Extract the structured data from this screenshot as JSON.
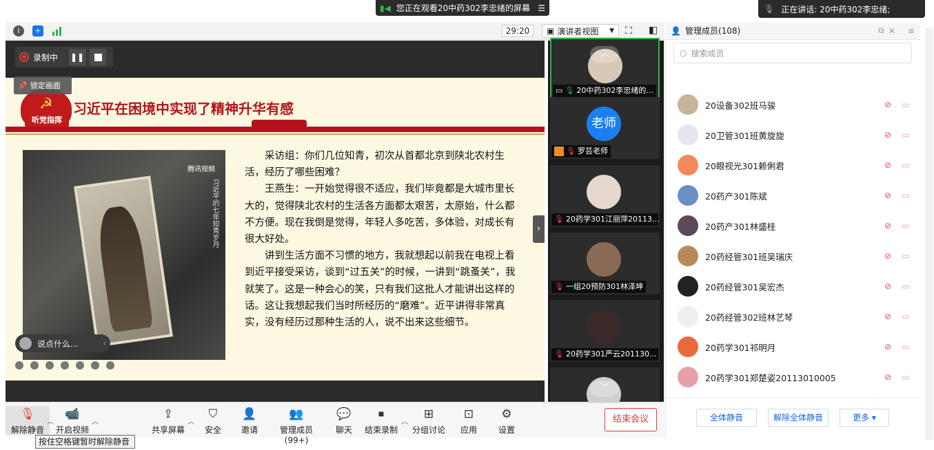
{
  "banner": {
    "share_text": "您正在观看20中药302李忠绪的屏幕",
    "speaking_text": "正在讲话: 20中药302李忠绪;"
  },
  "toolbar": {
    "timer": "29:20",
    "view_label": "演讲者视图"
  },
  "recording": {
    "label": "录制中",
    "lock_label": "锁定画面"
  },
  "slide": {
    "badge": "听党指挥",
    "title": "习近平在困境中实现了精神升华有感",
    "brand": "腾讯视频",
    "vertical_text": "习近平的七年知青岁月",
    "paragraphs": [
      "采访组：你们几位知青，初次从首都北京到陕北农村生活，经历了哪些困难？",
      "王燕生：一开始觉得很不适应，我们毕竟都是大城市里长大的，觉得陕北农村的生活各方面都太艰苦，太原始，什么都不方便。现在我倒是觉得，年轻人多吃苦，多体验，对成长有很大好处。",
      "讲到生活方面不习惯的地方，我就想起以前我在电视上看到近平接受采访，谈到“过五关”的时候，一讲到“跳蚤关”，我就笑了。这是一种会心的笑，只有我们这批人才能讲出这样的话。这让我想起我们当时所经历的“磨难”。近平讲得非常真实，没有经历过那种生活的人，说不出来这些细节。"
    ],
    "danmu_placeholder": "说点什么..."
  },
  "videos": [
    {
      "name": "20中药302李忠绪的...",
      "avatar_color": "#d8c9b6",
      "active": true
    },
    {
      "name": "罗芸老师",
      "avatar_text": "老师",
      "avatar_color": "#1a7ff0",
      "active": false
    },
    {
      "name": "20药学301江丽萍20113...",
      "avatar_color": "#e7d8cf",
      "active": false
    },
    {
      "name": "一组20预防301林泽坤",
      "avatar_color": "#8a6a55",
      "active": false
    },
    {
      "name": "20药学301严云201130...",
      "avatar_color": "#3a2a2a",
      "active": false
    },
    {
      "name": "",
      "avatar_color": "#cfcfcf",
      "active": false
    }
  ],
  "panel": {
    "title": "管理成员(108)",
    "search_placeholder": "搜索成员",
    "members": [
      {
        "name": "20设备302班马骏",
        "color": "#c9b49a"
      },
      {
        "name": "20卫管301班黄旋旋",
        "color": "#e8e4f2"
      },
      {
        "name": "20眼视光301赖俐君",
        "color": "#f28a5a"
      },
      {
        "name": "20药产301陈斌",
        "color": "#6a8fc4"
      },
      {
        "name": "20药产301林盛桂",
        "color": "#5a4a5a"
      },
      {
        "name": "20药经管301班吴瑞庆",
        "color": "#b88a5a"
      },
      {
        "name": "20药经管301吴宏杰",
        "color": "#222222"
      },
      {
        "name": "20药经管302班林艺琴",
        "color": "#eeeeee"
      },
      {
        "name": "20药学301祁明月",
        "color": "#e86a3a"
      },
      {
        "name": "20药学301郑楚姿20113010005",
        "color": "#e8a0a8"
      }
    ],
    "mute_all": "全体静音",
    "unmute_all": "解除全体静音",
    "more": "更多"
  },
  "bottom": {
    "unmute": "解除静音",
    "video": "开启视频",
    "share": "共享屏幕",
    "security": "安全",
    "invite": "邀请",
    "members": "管理成员(99+)",
    "chat": "聊天",
    "stop_record": "结束录制",
    "breakout": "分组讨论",
    "apps": "应用",
    "settings": "设置",
    "end_meeting": "结束会议",
    "tooltip": "按住空格键暂时解除静音"
  }
}
